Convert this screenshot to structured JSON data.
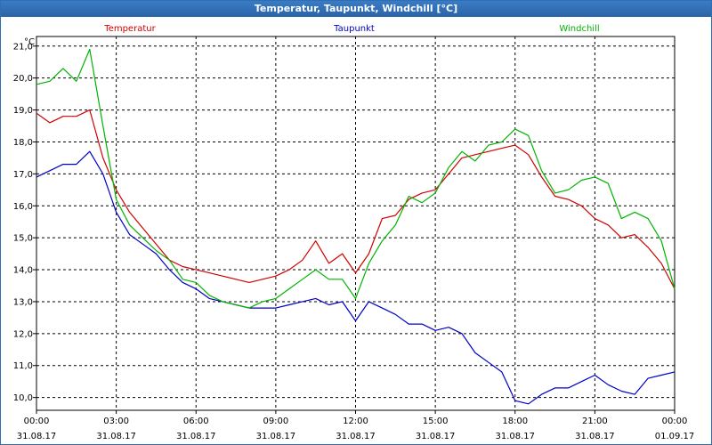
{
  "window": {
    "title": "Temperatur, Taupunkt, Windchill [°C]"
  },
  "chart_data": {
    "type": "line",
    "title": "Temperatur, Taupunkt, Windchill [°C]",
    "ylabel": "°C",
    "ylim": [
      9.6,
      21.3
    ],
    "xlim": [
      0,
      24
    ],
    "grid": true,
    "legend_placement": "top",
    "y_ticks": [
      "10,0",
      "11,0",
      "12,0",
      "13,0",
      "14,0",
      "15,0",
      "16,0",
      "17,0",
      "18,0",
      "19,0",
      "20,0",
      "21,0"
    ],
    "x_ticks": [
      {
        "time": "00:00",
        "date": "31.08.17"
      },
      {
        "time": "03:00",
        "date": "31.08.17"
      },
      {
        "time": "06:00",
        "date": "31.08.17"
      },
      {
        "time": "09:00",
        "date": "31.08.17"
      },
      {
        "time": "12:00",
        "date": "31.08.17"
      },
      {
        "time": "15:00",
        "date": "31.08.17"
      },
      {
        "time": "18:00",
        "date": "31.08.17"
      },
      {
        "time": "21:00",
        "date": "31.08.17"
      },
      {
        "time": "00:00",
        "date": "01.09.17"
      }
    ],
    "x_hours": [
      0,
      0.5,
      1,
      1.5,
      2,
      2.5,
      3,
      3.5,
      4,
      4.5,
      5,
      5.5,
      6,
      6.5,
      7,
      7.5,
      8,
      8.5,
      9,
      9.5,
      10,
      10.5,
      11,
      11.5,
      12,
      12.5,
      13,
      13.5,
      14,
      14.5,
      15,
      15.5,
      16,
      16.5,
      17,
      17.5,
      18,
      18.5,
      19,
      19.5,
      20,
      20.5,
      21,
      21.5,
      22,
      22.5,
      23,
      23.5,
      24
    ],
    "series": [
      {
        "name": "Temperatur",
        "color": "#d00000",
        "values": [
          18.9,
          18.6,
          18.8,
          18.8,
          19.0,
          17.5,
          16.5,
          15.8,
          15.3,
          14.8,
          14.3,
          14.1,
          14.0,
          13.9,
          13.8,
          13.7,
          13.6,
          13.7,
          13.8,
          14.0,
          14.3,
          14.9,
          14.2,
          14.5,
          13.9,
          14.5,
          15.6,
          15.7,
          16.2,
          16.4,
          16.5,
          17.0,
          17.5,
          17.6,
          17.7,
          17.8,
          17.9,
          17.6,
          16.9,
          16.3,
          16.2,
          16.0,
          15.6,
          15.4,
          15.0,
          15.1,
          14.7,
          14.2,
          13.4
        ]
      },
      {
        "name": "Taupunkt",
        "color": "#0000c8",
        "values": [
          16.9,
          17.1,
          17.3,
          17.3,
          17.7,
          17.0,
          15.8,
          15.1,
          14.8,
          14.5,
          14.0,
          13.6,
          13.4,
          13.1,
          13.0,
          12.9,
          12.8,
          12.8,
          12.8,
          12.9,
          13.0,
          13.1,
          12.9,
          13.0,
          12.4,
          13.0,
          12.8,
          12.6,
          12.3,
          12.3,
          12.1,
          12.2,
          12.0,
          11.4,
          11.1,
          10.8,
          9.9,
          9.8,
          10.1,
          10.3,
          10.3,
          10.5,
          10.7,
          10.4,
          10.2,
          10.1,
          10.6,
          10.7,
          10.8
        ]
      },
      {
        "name": "Windchill",
        "color": "#00b400",
        "values": [
          19.8,
          19.9,
          20.3,
          19.9,
          20.9,
          18.5,
          16.2,
          15.4,
          15.0,
          14.6,
          14.3,
          13.7,
          13.6,
          13.2,
          13.0,
          12.9,
          12.8,
          13.0,
          13.1,
          13.4,
          13.7,
          14.0,
          13.7,
          13.7,
          13.1,
          14.2,
          14.9,
          15.4,
          16.3,
          16.1,
          16.4,
          17.2,
          17.7,
          17.4,
          17.9,
          18.0,
          18.4,
          18.2,
          17.1,
          16.4,
          16.5,
          16.8,
          16.9,
          16.7,
          15.6,
          15.8,
          15.6,
          14.9,
          13.4
        ]
      }
    ]
  }
}
